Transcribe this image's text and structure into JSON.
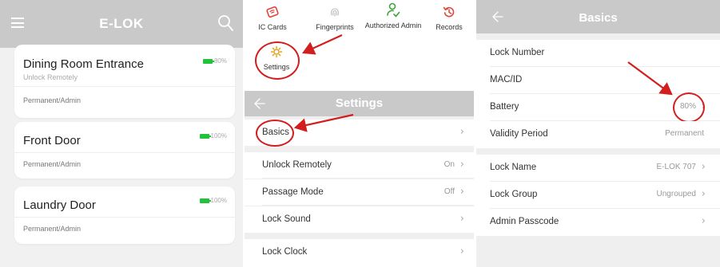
{
  "lock_list": {
    "title": "E-LOK",
    "locks": [
      {
        "name": "Dining Room Entrance",
        "status": "Unlock Remotely",
        "access": "Permanent/Admin",
        "battery": "80%",
        "battery_level": 0.8
      },
      {
        "name": "Front Door",
        "status": "",
        "access": "Permanent/Admin",
        "battery": "100%",
        "battery_level": 1.0
      },
      {
        "name": "Laundry Door",
        "status": "",
        "access": "Permanent/Admin",
        "battery": "100%",
        "battery_level": 1.0
      }
    ]
  },
  "settings_panel": {
    "quick_actions": [
      {
        "label": "IC Cards",
        "icon": "ic-card-icon"
      },
      {
        "label": "Fingerprints",
        "icon": "fingerprint-icon"
      },
      {
        "label": "Authorized Admin",
        "icon": "authorized-admin-icon"
      },
      {
        "label": "Records",
        "icon": "records-icon"
      },
      {
        "label": "Settings",
        "icon": "settings-icon"
      }
    ],
    "title": "Settings",
    "rows": [
      {
        "label": "Basics",
        "value": ""
      },
      {
        "label": "Unlock Remotely",
        "value": "On"
      },
      {
        "label": "Passage Mode",
        "value": "Off"
      },
      {
        "label": "Lock Sound",
        "value": ""
      },
      {
        "label": "Lock Clock",
        "value": ""
      }
    ]
  },
  "basics_panel": {
    "title": "Basics",
    "rows": [
      {
        "label": "Lock Number",
        "value": ""
      },
      {
        "label": "MAC/ID",
        "value": ""
      },
      {
        "label": "Battery",
        "value": "80%"
      },
      {
        "label": "Validity Period",
        "value": "Permanent"
      },
      {
        "label": "Lock Name",
        "value": "E-LOK 707"
      },
      {
        "label": "Lock Group",
        "value": "Ungrouped"
      },
      {
        "label": "Admin Passcode",
        "value": ""
      }
    ]
  },
  "colors": {
    "header_gray": "#c9c9c9",
    "battery_green": "#22c23a",
    "icon_red": "#e0443a",
    "icon_green": "#3aa63a",
    "annotation_red": "#d21e1e"
  }
}
